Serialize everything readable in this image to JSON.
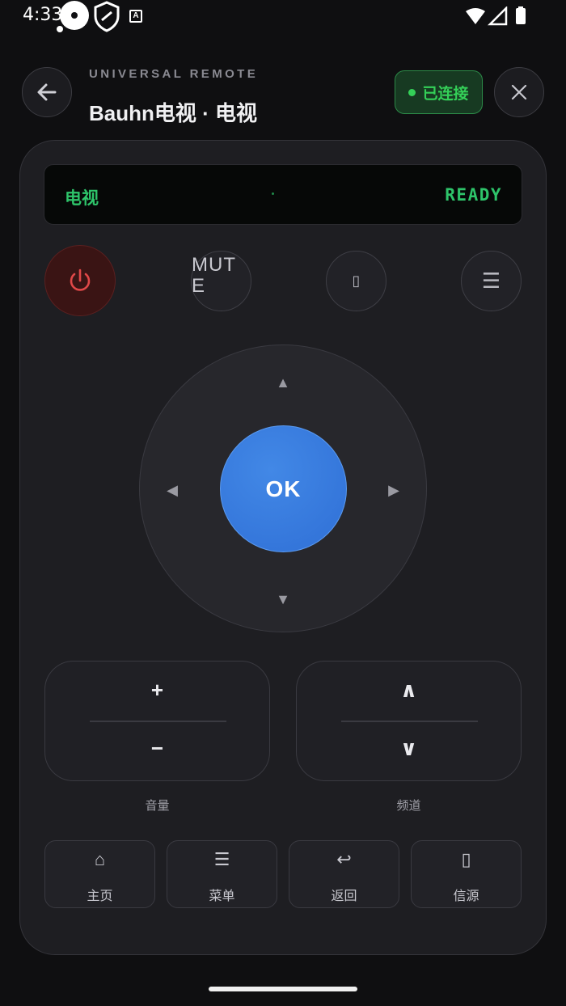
{
  "status_bar": {
    "time": "4:33"
  },
  "header": {
    "eyebrow": "UNIVERSAL REMOTE",
    "title": "Bauhn电视 · 电视",
    "status": "已连接"
  },
  "display": {
    "left": "电视",
    "right": "READY"
  },
  "buttons": {
    "mute_label": "MUTE",
    "tv_icon": "▯",
    "menu_icon": "☰",
    "ok_label": "OK",
    "arrow_up": "▲",
    "arrow_down": "▼",
    "arrow_left": "◀",
    "arrow_right": "▶"
  },
  "volume": {
    "up": "+",
    "down": "−",
    "label": "音量"
  },
  "channel": {
    "up": "∧",
    "down": "∨",
    "label": "频道"
  },
  "function_buttons": [
    {
      "icon": "⌂",
      "label": "主页"
    },
    {
      "icon": "☰",
      "label": "菜单"
    },
    {
      "icon": "↩",
      "label": "返回"
    },
    {
      "icon": "▯",
      "label": "信源"
    }
  ],
  "colors": {
    "accent_blue": "#3a7be0",
    "connected_green": "#34d058",
    "power_red": "#e04848"
  }
}
